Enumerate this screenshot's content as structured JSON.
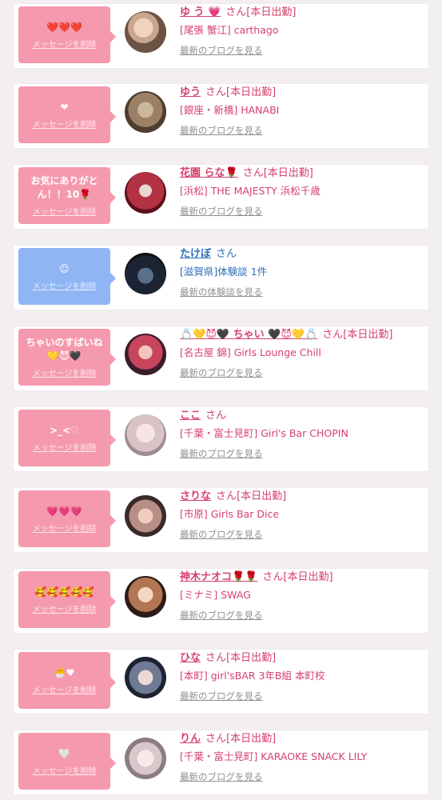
{
  "delete_label": "メッセージを削除",
  "entries": [
    {
      "message": "❤️❤️❤️",
      "name": "ゆ う 💗",
      "honorific": "さん",
      "status": "[本日出勤]",
      "shop": "[尾張 蟹江] carthago",
      "link": "最新のブログを見る",
      "bubble_color": "pink"
    },
    {
      "message": "❤",
      "name": "ゆう",
      "honorific": "さん",
      "status": "[本日出勤]",
      "shop": "[銀座・新橋] HANABI",
      "link": "最新のブログを見る",
      "bubble_color": "pink"
    },
    {
      "message": "お気にありがとん！！10🌹",
      "name": "花園 らな🌹",
      "honorific": "さん",
      "status": "[本日出勤]",
      "shop": "[浜松] THE MAJESTY 浜松千歳",
      "link": "最新のブログを見る",
      "bubble_color": "pink"
    },
    {
      "message": "☺",
      "name": "たけぼ",
      "honorific": "さん",
      "status": "",
      "shop": "[滋賀県]体験談 1件",
      "link": "最新の体験談を見る",
      "bubble_color": "blue"
    },
    {
      "message": "ちゃいのすばいね💛😈🖤",
      "name": "💍💛😈🖤 ちゃい 🖤😈💛💍",
      "honorific": "さん",
      "status": "[本日出勤]",
      "shop": "[名古屋 錦] Girls Lounge Chill",
      "link": "最新のブログを見る",
      "bubble_color": "pink"
    },
    {
      "message": ">_<♡",
      "name": "ここ",
      "honorific": "さん",
      "status": "",
      "shop": "[千葉・富士見町] Girl's Bar CHOPIN",
      "link": "最新のブログを見る",
      "bubble_color": "pink"
    },
    {
      "message": "💗💗💗",
      "name": "さりな",
      "honorific": "さん",
      "status": "[本日出勤]",
      "shop": "[市原] Girls Bar Dice",
      "link": "最新のブログを見る",
      "bubble_color": "pink"
    },
    {
      "message": "🥰🥰🥰🥰🥰",
      "name": "神木ナオコ🌹🌹",
      "honorific": "さん",
      "status": "[本日出勤]",
      "shop": "[ミナミ] SWAG",
      "link": "最新のブログを見る",
      "bubble_color": "pink"
    },
    {
      "message": "🐣♥",
      "name": "ひな",
      "honorific": "さん",
      "status": "[本日出勤]",
      "shop": "[本町] girl'sBAR 3年B組 本町校",
      "link": "最新のブログを見る",
      "bubble_color": "pink"
    },
    {
      "message": "🤍",
      "name": "りん",
      "honorific": "さん",
      "status": "[本日出勤]",
      "shop": "[千葉・富士見町] KARAOKE SNACK LILY",
      "link": "最新のブログを見る",
      "bubble_color": "pink"
    }
  ]
}
